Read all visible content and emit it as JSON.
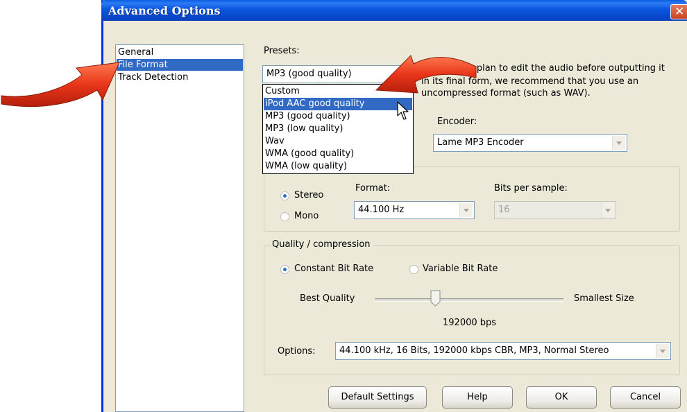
{
  "window": {
    "title": "Advanced Options",
    "close_glyph": "✕"
  },
  "nav": {
    "items": [
      {
        "label": "General",
        "selected": false
      },
      {
        "label": "File Format",
        "selected": true
      },
      {
        "label": "Track Detection",
        "selected": false
      }
    ]
  },
  "presets": {
    "label": "Presets:",
    "value": "MP3 (good quality)",
    "options": [
      {
        "label": "Custom",
        "highlighted": false
      },
      {
        "label": "iPod AAC good quality",
        "highlighted": true
      },
      {
        "label": "MP3 (good quality)",
        "highlighted": false
      },
      {
        "label": "MP3 (low quality)",
        "highlighted": false
      },
      {
        "label": "Wav",
        "highlighted": false
      },
      {
        "label": "WMA (good quality)",
        "highlighted": false
      },
      {
        "label": "WMA (low quality)",
        "highlighted": false
      }
    ]
  },
  "hint": {
    "line1": "Note: If you plan to edit the audio before outputting it",
    "line2": "in its final form, we recommend that you use an",
    "line3": "uncompressed format (such as WAV)."
  },
  "encoder": {
    "label": "Encoder:",
    "value": "Lame MP3 Encoder"
  },
  "channels": {
    "stereo": "Stereo",
    "mono": "Mono",
    "selected": "Stereo"
  },
  "format": {
    "label": "Format:",
    "value": "44.100 Hz"
  },
  "bits": {
    "label": "Bits per sample:",
    "value": "16",
    "enabled": false
  },
  "quality": {
    "legend": "Quality / compression",
    "cbr": "Constant Bit Rate",
    "vbr": "Variable Bit Rate",
    "selected": "Constant Bit Rate",
    "left_label": "Best Quality",
    "right_label": "Smallest Size",
    "slider_level": 0.32,
    "bitrate": "192000 bps",
    "options_label": "Options:",
    "options_value": "44.100 kHz, 16 Bits, 192000 kbps CBR, MP3, Normal Stereo"
  },
  "buttons": {
    "default": "Default Settings",
    "help": "Help",
    "ok": "OK",
    "cancel": "Cancel"
  },
  "colors": {
    "title_bar": "#0a55de",
    "selection": "#316ac5",
    "arrow": "#e8361a",
    "dialog_bg": "#ece9d8"
  },
  "annotations": {
    "arrow_left": "red-arrow-icon",
    "arrow_right": "red-arrow-icon"
  }
}
